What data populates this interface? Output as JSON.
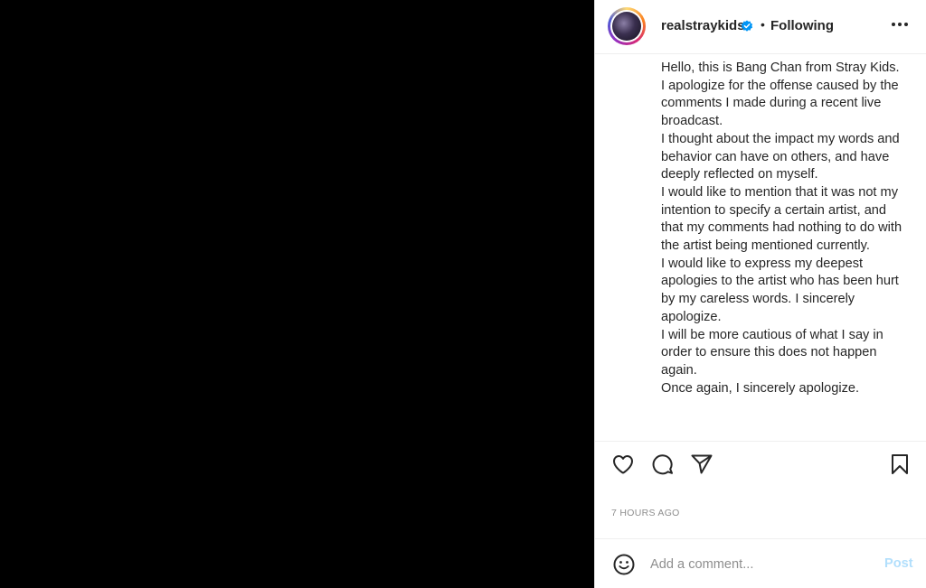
{
  "post": {
    "username": "realstraykids",
    "separator": "•",
    "follow_status": "Following",
    "caption_lines": [
      "Hello, this is Bang Chan from Stray Kids.",
      "I apologize for the offense caused by the comments I made during a recent live broadcast.",
      "I thought about the impact my words and behavior can have on others, and have deeply reflected on myself.",
      "I would like to mention that it was not my intention to specify a certain artist, and that my comments had nothing to do with the artist being mentioned currently.",
      "I would like to express my deepest apologies to the artist who has been hurt by my careless words. I sincerely apologize.",
      "I will be more cautious of what I say in order to ensure this does not happen again.",
      "Once again, I sincerely apologize."
    ],
    "timestamp": "7 HOURS AGO"
  },
  "comment_box": {
    "placeholder": "Add a comment...",
    "post_label": "Post"
  },
  "icons": {
    "verified": "verified-badge-icon",
    "more": "more-options-icon",
    "like": "heart-icon",
    "comment": "comment-bubble-icon",
    "share": "share-paper-plane-icon",
    "save": "bookmark-icon",
    "emoji": "emoji-smile-icon"
  },
  "colors": {
    "verified": "#0095f6",
    "post_disabled": "#b2dffc",
    "timestamp": "#8e8e8e",
    "media_background": "#000000"
  }
}
